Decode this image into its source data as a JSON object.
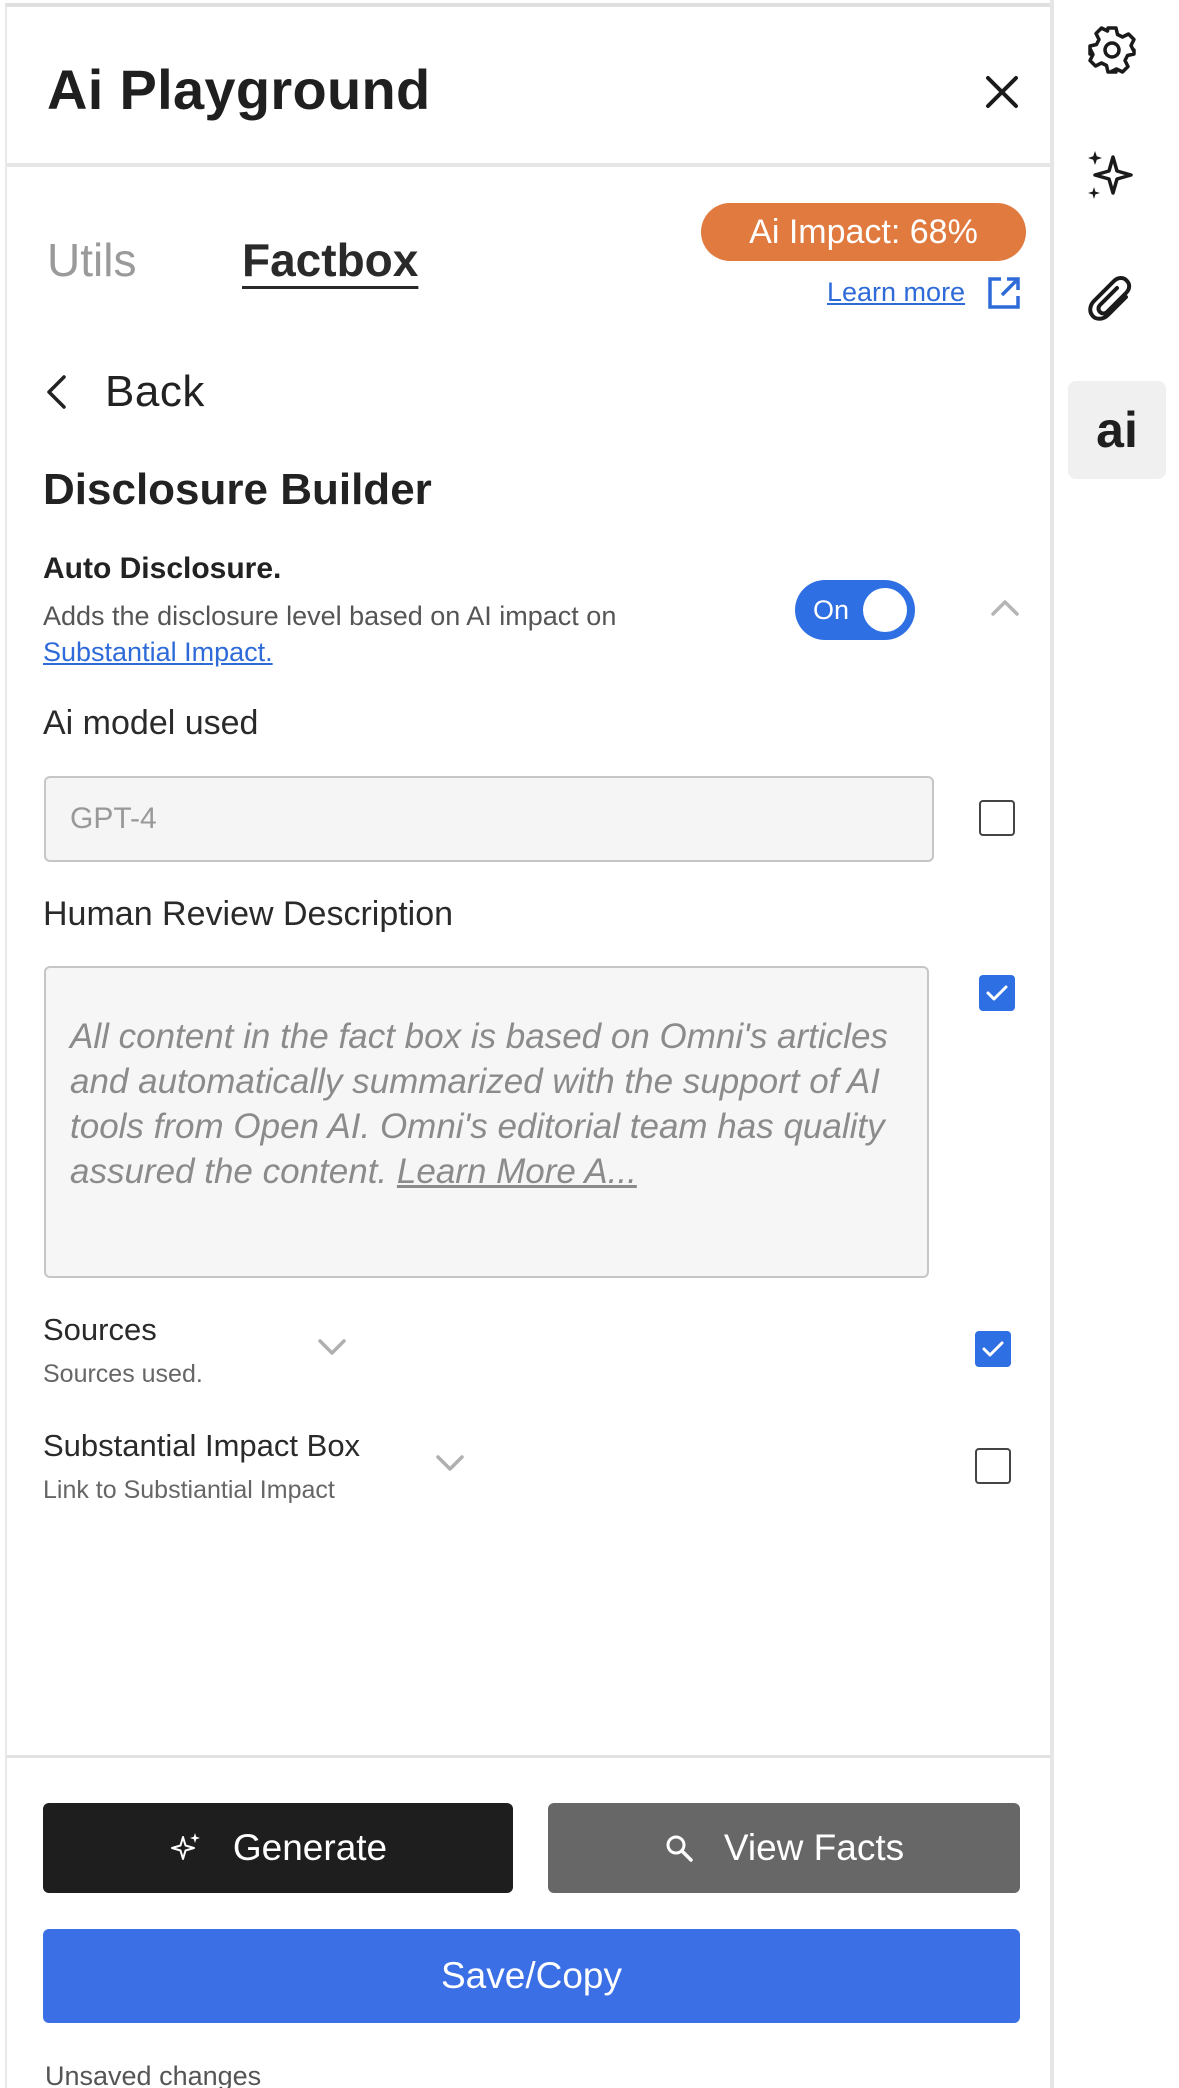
{
  "header": {
    "title": "Ai Playground"
  },
  "tabs": [
    {
      "label": "Utils"
    },
    {
      "label": "Factbox"
    }
  ],
  "impact": {
    "badge": "Ai Impact: 68%",
    "learn_more": "Learn more",
    "color": "#e07a3e"
  },
  "back": {
    "label": "Back"
  },
  "builder": {
    "title": "Disclosure Builder",
    "auto": {
      "title": "Auto Disclosure.",
      "description": "Adds the disclosure level based on AI impact on",
      "link": "Substantial Impact.",
      "toggle_label": "On"
    },
    "model": {
      "label": "Ai model used",
      "placeholder": "GPT-4"
    },
    "review": {
      "label": "Human Review Description",
      "text": "All content in the fact box is based on Omni's articles and automatically summarized with the support of AI tools from Open AI. Omni's editorial team has quality assured the content. ",
      "more": "Learn More A..."
    },
    "sources": {
      "title": "Sources",
      "subtitle": "Sources used."
    },
    "impact_box": {
      "title": "Substantial Impact Box",
      "subtitle": "Link to Substiantial Impact"
    }
  },
  "actions": {
    "generate": "Generate",
    "view_facts": "View Facts",
    "save": "Save/Copy"
  },
  "status": {
    "unsaved": "Unsaved changes"
  },
  "rail": {
    "ai_label": "ai"
  },
  "icons": [
    "close-icon",
    "external-link-icon",
    "chevron-left-icon",
    "chevron-up-icon",
    "chevron-down-icon",
    "sparkle-icon",
    "search-icon",
    "gear-icon",
    "paperclip-icon"
  ],
  "colors": {
    "primary": "#3b6fe6",
    "toggle": "#2f6fe4",
    "dark_button": "#1e1e1e",
    "gray_button": "#676767"
  }
}
